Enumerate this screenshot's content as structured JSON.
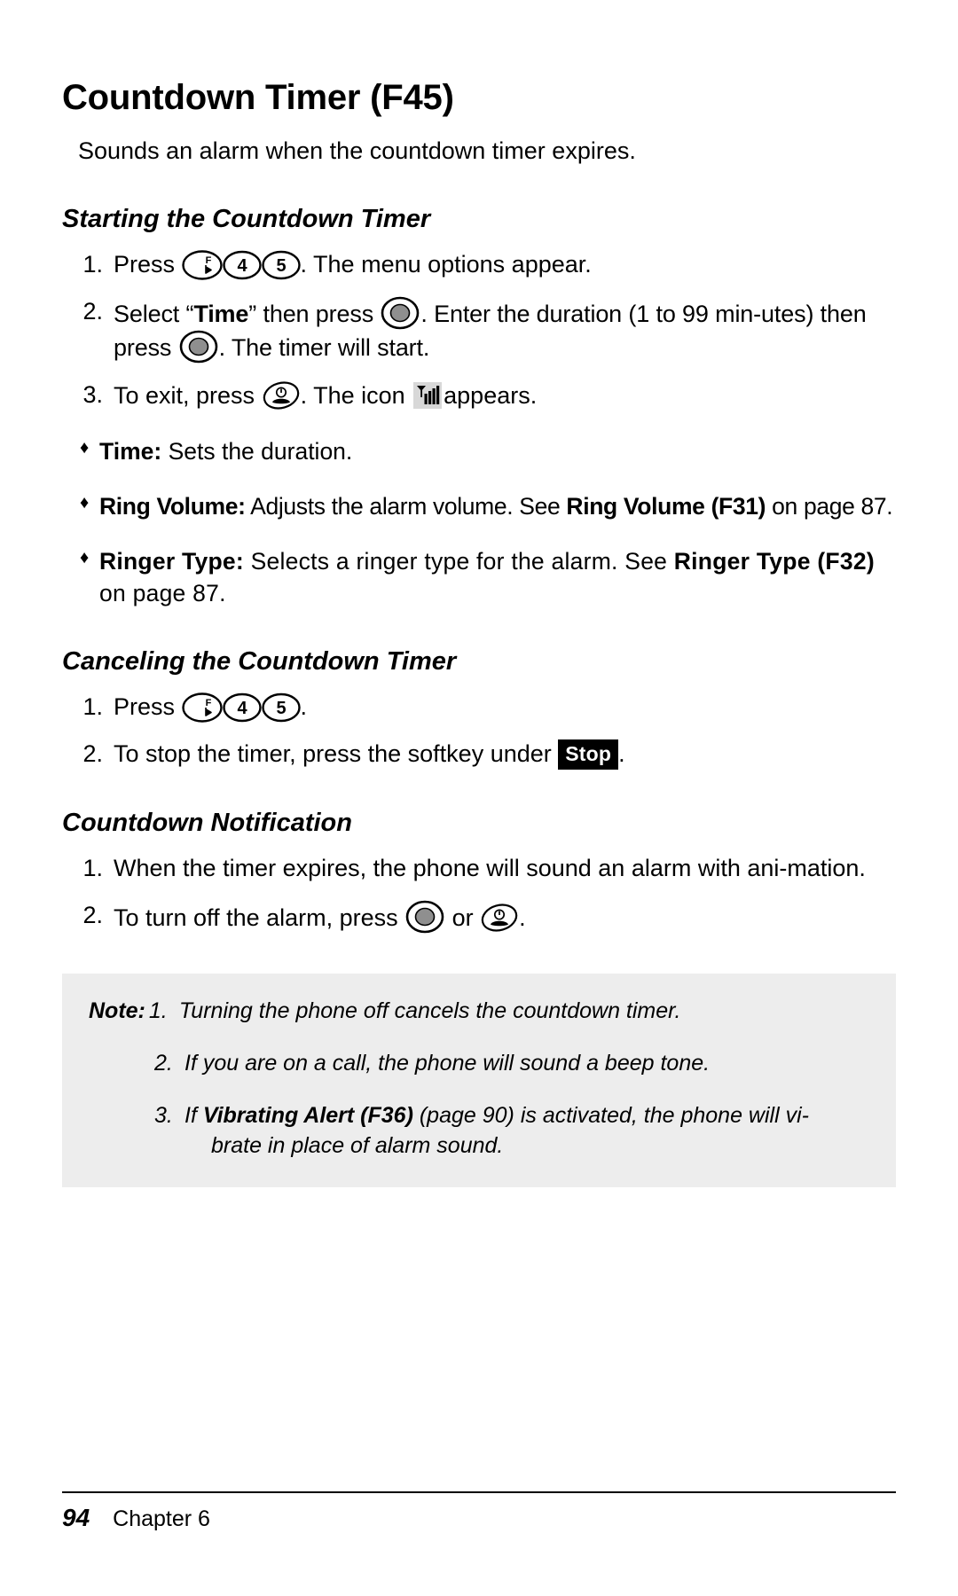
{
  "page": {
    "title": "Countdown Timer (F45)",
    "intro": "Sounds an alarm when the countdown timer expires."
  },
  "sections": {
    "starting": {
      "heading": "Starting the Countdown Timer",
      "steps": [
        {
          "num": "1.",
          "pre": "Press ",
          "keys": [
            "function-key",
            "key-4",
            "key-5"
          ],
          "post": ". The menu options appear."
        },
        {
          "num": "2.",
          "part1": "Select “",
          "bold1": "Time",
          "part2": "” then press ",
          "key1": "ok-key",
          "part3": ". Enter the duration (1 to 99 min-utes) then press ",
          "key2": "ok-key",
          "part4": ". The timer will start."
        },
        {
          "num": "3.",
          "pre": "To exit, press ",
          "key": "end-call-key",
          "mid": ". The icon ",
          "icon": "signal-strength-icon",
          "post": "appears."
        }
      ],
      "bullets": [
        {
          "mark": "♦",
          "bold": "Time:",
          "text": " Sets the duration."
        },
        {
          "mark": "♦",
          "bold": "Ring Volume:",
          "text": " Adjusts the alarm volume. See ",
          "bold2": "Ring Volume (F31)",
          "text2": " on page 87."
        },
        {
          "mark": "♦",
          "bold": "Ringer Type:",
          "text": " Selects a ringer type for the alarm.  See ",
          "bold2": "Ringer Type (F32)",
          "text2": " on page 87."
        }
      ]
    },
    "canceling": {
      "heading": "Canceling the Countdown Timer",
      "steps": [
        {
          "num": "1.",
          "pre": "Press ",
          "keys": [
            "function-key",
            "key-4",
            "key-5"
          ],
          "post": "."
        },
        {
          "num": "2.",
          "pre": "To stop the timer, press the softkey under ",
          "softkey": "Stop",
          "post": "."
        }
      ]
    },
    "notification": {
      "heading": "Countdown Notification",
      "steps": [
        {
          "num": "1.",
          "text": "When the timer expires, the phone will sound an alarm with ani-mation."
        },
        {
          "num": "2.",
          "pre": "To turn off the alarm, press ",
          "key1": "ok-key",
          "mid": " or ",
          "key2": "end-call-key",
          "post": "."
        }
      ]
    }
  },
  "note": {
    "label": "Note:",
    "items": [
      {
        "num": "1.",
        "text": "Turning the phone off cancels the countdown timer."
      },
      {
        "num": "2.",
        "text": "If you are on a call, the phone will sound a beep tone."
      },
      {
        "num": "3.",
        "pre": "If ",
        "bold": "Vibrating Alert (F36)",
        "post": " (page 90) is activated, the phone will vi-",
        "cont": "brate in place of alarm sound."
      }
    ]
  },
  "footer": {
    "page_number": "94",
    "chapter": "Chapter 6"
  },
  "key_labels": {
    "function": "F",
    "four": "4",
    "five": "5"
  },
  "colors": {
    "ok_key_fill": "#8f8f8f",
    "note_background": "#ededed",
    "softkey_background": "#000000",
    "signal_icon_background": "#d8d8d8"
  }
}
